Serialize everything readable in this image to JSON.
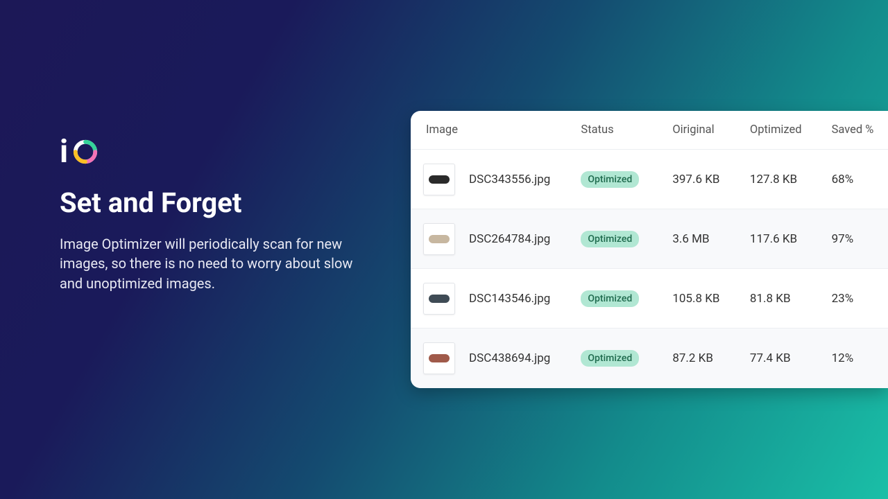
{
  "hero": {
    "logo_text": "i",
    "title": "Set and Forget",
    "description": "Image Optimizer will periodically scan for new images, so there is no need to worry about slow and unoptimized images."
  },
  "table": {
    "headers": {
      "image": "Image",
      "status": "Status",
      "original": "Oiriginal",
      "optimized": "Optimized",
      "saved": "Saved %"
    },
    "rows": [
      {
        "filename": "DSC343556.jpg",
        "status": "Optimized",
        "original": "397.6 KB",
        "optimized": "127.8 KB",
        "saved": "68%",
        "thumb_color": "#2a2a2a"
      },
      {
        "filename": "DSC264784.jpg",
        "status": "Optimized",
        "original": "3.6 MB",
        "optimized": "117.6 KB",
        "saved": "97%",
        "thumb_color": "#c7b7a0"
      },
      {
        "filename": "DSC143546.jpg",
        "status": "Optimized",
        "original": "105.8 KB",
        "optimized": "81.8 KB",
        "saved": "23%",
        "thumb_color": "#3f4b55"
      },
      {
        "filename": "DSC438694.jpg",
        "status": "Optimized",
        "original": "87.2 KB",
        "optimized": "77.4 KB",
        "saved": "12%",
        "thumb_color": "#a05a4a"
      }
    ]
  }
}
